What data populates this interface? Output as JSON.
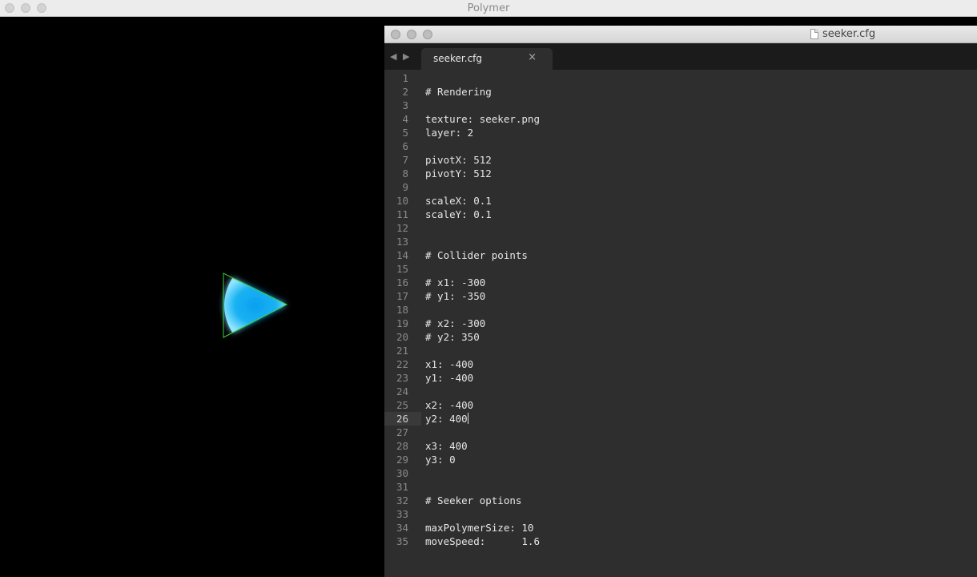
{
  "app": {
    "title": "Polymer"
  },
  "editor": {
    "title": "seeker.cfg",
    "tab_label": "seeker.cfg",
    "tab_close": "×",
    "nav_back": "◀",
    "nav_forward": "▶",
    "active_line": 26,
    "lines": [
      "",
      "# Rendering",
      "",
      "texture: seeker.png",
      "layer: 2",
      "",
      "pivotX: 512",
      "pivotY: 512",
      "",
      "scaleX: 0.1",
      "scaleY: 0.1",
      "",
      "",
      "# Collider points",
      "",
      "# x1: -300",
      "# y1: -350",
      "",
      "# x2: -300",
      "# y2: 350",
      "",
      "x1: -400",
      "y1: -400",
      "",
      "x2: -400",
      "y2: 400",
      "",
      "x3: 400",
      "y3: 0",
      "",
      "",
      "# Seeker options",
      "",
      "maxPolymerSize: 10",
      "moveSpeed:      1.6"
    ]
  },
  "colors": {
    "seeker_fill": "#1aa8ee",
    "collider_outline": "#3cd23c"
  }
}
